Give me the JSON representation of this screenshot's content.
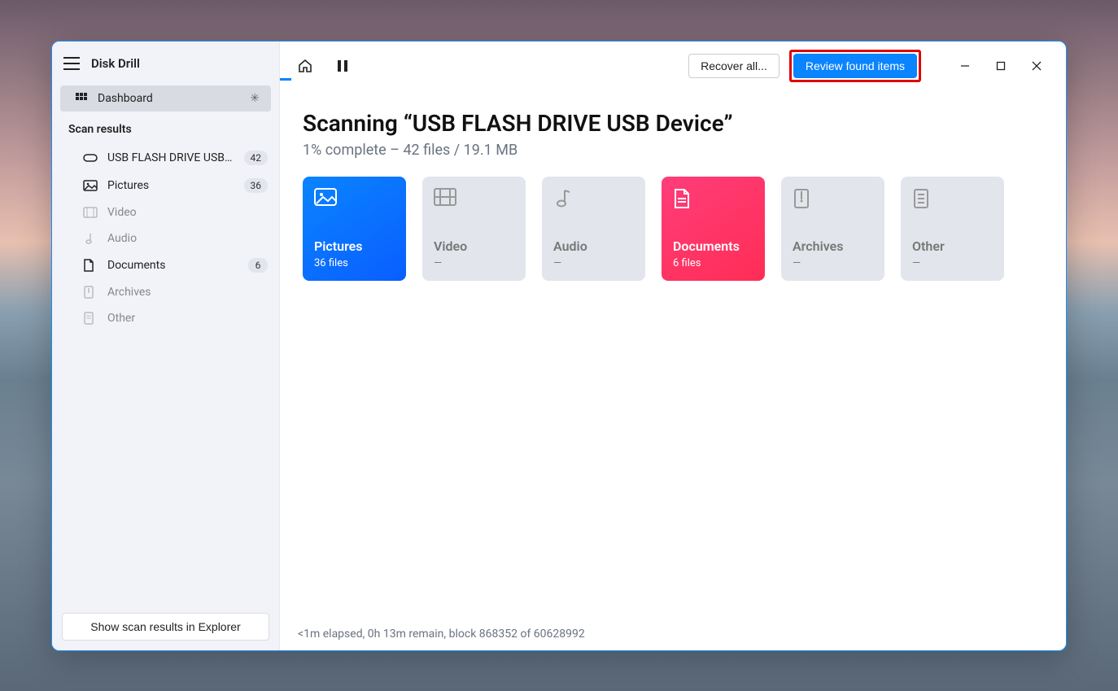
{
  "app_name": "Disk Drill",
  "nav": {
    "dashboard": "Dashboard"
  },
  "sidebar": {
    "section_label": "Scan results",
    "items": [
      {
        "label": "USB FLASH DRIVE USB D...",
        "count": "42"
      },
      {
        "label": "Pictures",
        "count": "36"
      },
      {
        "label": "Video",
        "count": ""
      },
      {
        "label": "Audio",
        "count": ""
      },
      {
        "label": "Documents",
        "count": "6"
      },
      {
        "label": "Archives",
        "count": ""
      },
      {
        "label": "Other",
        "count": ""
      }
    ],
    "explorer_btn": "Show scan results in Explorer"
  },
  "toolbar": {
    "recover_all": "Recover all...",
    "review": "Review found items"
  },
  "main": {
    "title": "Scanning “USB FLASH DRIVE USB Device”",
    "subtitle": "1% complete – 42 files / 19.1 MB"
  },
  "cards": [
    {
      "title": "Pictures",
      "count": "36 files",
      "variant": "blue"
    },
    {
      "title": "Video",
      "count": "—",
      "variant": "grey"
    },
    {
      "title": "Audio",
      "count": "—",
      "variant": "grey"
    },
    {
      "title": "Documents",
      "count": "6 files",
      "variant": "pink"
    },
    {
      "title": "Archives",
      "count": "—",
      "variant": "grey"
    },
    {
      "title": "Other",
      "count": "—",
      "variant": "grey"
    }
  ],
  "status": "<1m elapsed, 0h 13m remain, block 868352 of 60628992"
}
